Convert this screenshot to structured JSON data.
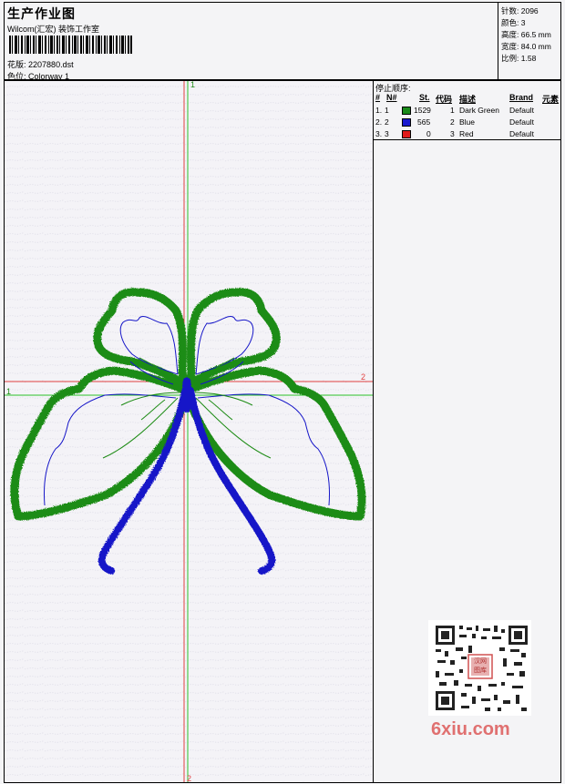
{
  "header": {
    "title": "生产作业图",
    "subtitle": "Wilcom(汇宏) 装饰工作室",
    "design_label": "花版:",
    "design_file": "2207880.dst",
    "colorway_label": "色位:",
    "colorway": "Colorway 1"
  },
  "stats": {
    "stitches_label": "针数:",
    "stitches": "2096",
    "colors_label": "颜色:",
    "colors": "3",
    "height_label": "高度:",
    "height": "66.5 mm",
    "width_label": "宽度:",
    "width": "84.0 mm",
    "scale_label": "比例:",
    "scale": "1.58"
  },
  "axes": {
    "v_top": "1",
    "v_bottom": "2",
    "h_left": "1",
    "h_right": "2"
  },
  "stop_sequence": {
    "title": "停止顺序:",
    "headers": {
      "hash": "#",
      "no": "N#",
      "st": "St.",
      "code": "代码",
      "desc": "描述",
      "brand": "Brand",
      "element": "元素"
    },
    "rows": [
      {
        "idx": "1.",
        "no": "1",
        "color": "#1a8a1a",
        "st": "1529",
        "code": "1",
        "desc": "Dark Green",
        "brand": "Default"
      },
      {
        "idx": "2.",
        "no": "2",
        "color": "#1a1ad0",
        "st": "565",
        "code": "2",
        "desc": "Blue",
        "brand": "Default"
      },
      {
        "idx": "3.",
        "no": "3",
        "color": "#e01a1a",
        "st": "0",
        "code": "3",
        "desc": "Red",
        "brand": "Default"
      }
    ]
  },
  "watermark": {
    "qr_badge": "汉网图库",
    "site": "6xiu.com"
  }
}
